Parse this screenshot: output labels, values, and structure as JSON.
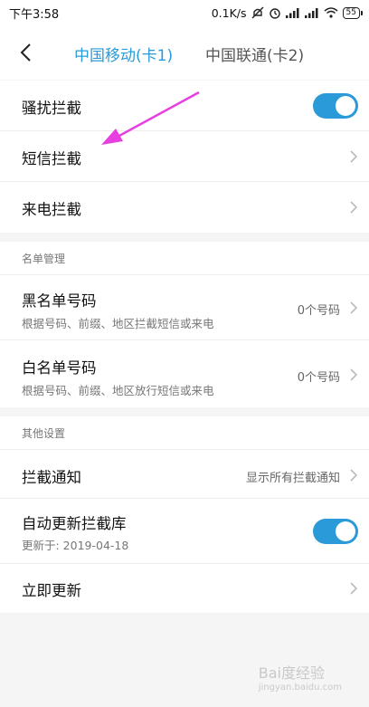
{
  "status_bar": {
    "time": "下午3:58",
    "speed": "0.1K/s",
    "battery": "55"
  },
  "header": {
    "tabs": [
      {
        "label": "中国移动(卡1)",
        "active": true
      },
      {
        "label": "中国联通(卡2)",
        "active": false
      }
    ]
  },
  "section1": {
    "rows": [
      {
        "title": "骚扰拦截",
        "control": "toggle",
        "on": true
      },
      {
        "title": "短信拦截",
        "control": "chevron"
      },
      {
        "title": "来电拦截",
        "control": "chevron"
      }
    ]
  },
  "section2": {
    "header": "名单管理",
    "rows": [
      {
        "title": "黑名单号码",
        "subtitle": "根据号码、前缀、地区拦截短信或来电",
        "value": "0个号码"
      },
      {
        "title": "白名单号码",
        "subtitle": "根据号码、前缀、地区放行短信或来电",
        "value": "0个号码"
      }
    ]
  },
  "section3": {
    "header": "其他设置",
    "rows": [
      {
        "title": "拦截通知",
        "value": "显示所有拦截通知",
        "control": "chevron"
      },
      {
        "title": "自动更新拦截库",
        "subtitle": "更新于: 2019-04-18",
        "control": "toggle",
        "on": true
      },
      {
        "title": "立即更新",
        "control": "chevron"
      }
    ]
  },
  "watermark": {
    "brand": "Bai度经验",
    "domain": "jingyan.baidu.com"
  },
  "colors": {
    "accent": "#2a9ad8",
    "annotation_arrow": "#e840e0"
  }
}
